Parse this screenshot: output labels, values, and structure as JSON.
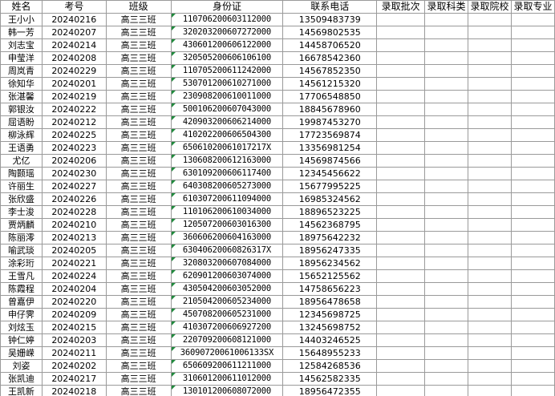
{
  "headers": [
    "姓名",
    "考号",
    "班级",
    "身份证",
    "联系电话",
    "录取批次",
    "录取科类",
    "录取院校",
    "录取专业"
  ],
  "rows": [
    [
      "王小小",
      "20240216",
      "高三三班",
      "110706200603112000",
      "13509483739"
    ],
    [
      "韩一芳",
      "20240207",
      "高三三班",
      "320203200607272000",
      "14569802535"
    ],
    [
      "刘志宝",
      "20240214",
      "高三三班",
      "430601200606122000",
      "14458706520"
    ],
    [
      "申莹洋",
      "20240208",
      "高三三班",
      "320505200606106100",
      "16678542360"
    ],
    [
      "周岚青",
      "20240229",
      "高三三班",
      "110705200611242000",
      "14567852350"
    ],
    [
      "徐知华",
      "20240201",
      "高三三班",
      "530701200610271000",
      "14561215320"
    ],
    [
      "张湛馨",
      "20240219",
      "高三三班",
      "230908200610011000",
      "17706548850"
    ],
    [
      "郭银汝",
      "20240222",
      "高三三班",
      "500106200607043000",
      "18845678960"
    ],
    [
      "屈语盼",
      "20240212",
      "高三三班",
      "420903200606214000",
      "19987453270"
    ],
    [
      "柳泳辉",
      "20240225",
      "高三三班",
      "410202200606504300",
      "17723569874"
    ],
    [
      "王语勇",
      "20240223",
      "高三三班",
      "65061020061017217X",
      "13356981254"
    ],
    [
      "尤亿",
      "20240206",
      "高三三班",
      "130608200612163000",
      "14569874566"
    ],
    [
      "陶颢瑶",
      "20240230",
      "高三三班",
      "630109200606117400",
      "12345456622"
    ],
    [
      "许丽生",
      "20240227",
      "高三三班",
      "640308200605273000",
      "15677995225"
    ],
    [
      "张欣盛",
      "20240226",
      "高三三班",
      "610307200611094000",
      "16985324562"
    ],
    [
      "李士浚",
      "20240228",
      "高三三班",
      "110106200610034000",
      "18896523225"
    ],
    [
      "贾炳麟",
      "20240210",
      "高三三班",
      "120507200603016300",
      "14562368795"
    ],
    [
      "陈丽澪",
      "20240213",
      "高三三班",
      "360606200604163000",
      "18975642232"
    ],
    [
      "喻武琰",
      "20240205",
      "高三三班",
      "63040620060826317X",
      "18956247335"
    ],
    [
      "涂彩珩",
      "20240221",
      "高三三班",
      "320803200607084000",
      "18956234562"
    ],
    [
      "王雪凡",
      "20240224",
      "高三三班",
      "620901200603074000",
      "15652125562"
    ],
    [
      "陈霞程",
      "20240204",
      "高三三班",
      "430504200603052000",
      "14758656223"
    ],
    [
      "曾嘉伊",
      "20240220",
      "高三三班",
      "210504200605234000",
      "18956478658"
    ],
    [
      "申仔霁",
      "20240209",
      "高三三班",
      "450708200605231000",
      "12345698725"
    ],
    [
      "刘炫玉",
      "20240215",
      "高三三班",
      "410307200606927200",
      "13245698752"
    ],
    [
      "钟仁婷",
      "20240203",
      "高三三班",
      "220709200608121000",
      "14403246525"
    ],
    [
      "吴姗嵘",
      "20240211",
      "高三三班",
      "36090720061006133SX",
      "15648955233"
    ],
    [
      "刘姿",
      "20240202",
      "高三三班",
      "650609200611211000",
      "12584268536"
    ],
    [
      "张凯迪",
      "20240217",
      "高三三班",
      "310601200611012000",
      "14562582335"
    ],
    [
      "王凯新",
      "20240218",
      "高三三班",
      "130101200608072000",
      "18956472355"
    ]
  ],
  "colors": {
    "grid": "#9a9a9a",
    "error_indicator": "#1f8a3c"
  }
}
